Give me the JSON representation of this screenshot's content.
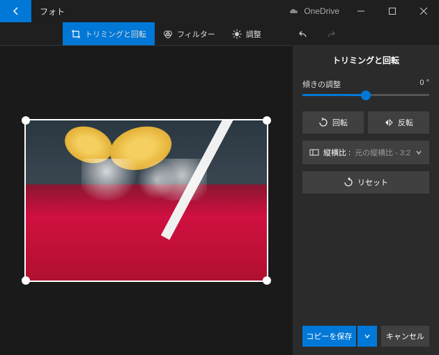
{
  "titlebar": {
    "app_title": "フォト",
    "onedrive_label": "OneDrive"
  },
  "toolbar": {
    "crop_rotate": "トリミングと回転",
    "filter": "フィルター",
    "adjust": "調整"
  },
  "panel": {
    "title": "トリミングと回転",
    "tilt_label": "傾きの調整",
    "tilt_value": "0 °",
    "rotate_label": "回転",
    "flip_label": "反転",
    "aspect_label": "縦横比 :",
    "aspect_value": "元の縦横比 - 3:2",
    "reset_label": "リセット"
  },
  "footer": {
    "save_label": "コピーを保存",
    "cancel_label": "キャンセル"
  }
}
